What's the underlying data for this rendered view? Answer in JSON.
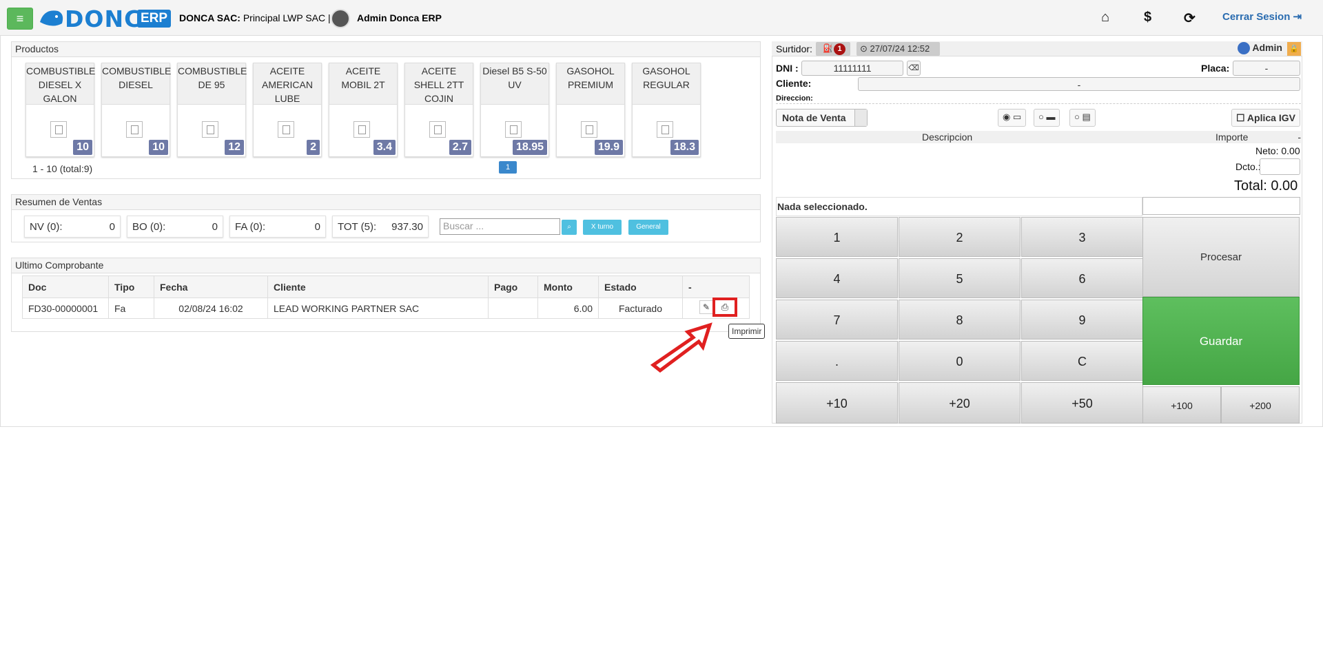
{
  "header": {
    "brand": "DONCA",
    "brand_suffix": "ERP",
    "company_label": "DONCA SAC:",
    "company_branch": "Principal LWP SAC |",
    "user": "Admin Donca ERP",
    "logout": "Cerrar Sesion"
  },
  "productos": {
    "title": "Productos",
    "pagination": "1 - 10 (total:9)",
    "page": "1",
    "items": [
      {
        "name": "COMBUSTIBLE DIESEL X GALON",
        "price": "10"
      },
      {
        "name": "COMBUSTIBLE DIESEL",
        "price": "10"
      },
      {
        "name": "COMBUSTIBLE DE 95",
        "price": "12"
      },
      {
        "name": "ACEITE AMERICAN LUBE",
        "price": "2"
      },
      {
        "name": "ACEITE MOBIL 2T",
        "price": "3.4"
      },
      {
        "name": "ACEITE SHELL 2TT COJIN",
        "price": "2.7"
      },
      {
        "name": "Diesel B5 S-50 UV",
        "price": "18.95"
      },
      {
        "name": "GASOHOL PREMIUM",
        "price": "19.9"
      },
      {
        "name": "GASOHOL REGULAR",
        "price": "18.3"
      }
    ]
  },
  "resumen": {
    "title": "Resumen de Ventas",
    "nv_label": "NV (0):",
    "nv_val": "0",
    "bo_label": "BO (0):",
    "bo_val": "0",
    "fa_label": "FA (0):",
    "fa_val": "0",
    "tot_label": "TOT (5):",
    "tot_val": "937.30",
    "search_placeholder": "Buscar ...",
    "xturno": "X turno",
    "general": "General"
  },
  "ultimo": {
    "title": "Ultimo Comprobante",
    "headers": [
      "Doc",
      "Tipo",
      "Fecha",
      "Cliente",
      "Pago",
      "Monto",
      "Estado",
      "-"
    ],
    "row": {
      "doc": "FD30-00000001",
      "tipo": "Fa",
      "fecha": "02/08/24 16:02",
      "cliente": "LEAD WORKING PARTNER SAC",
      "pago": "",
      "monto": "6.00",
      "estado": "Facturado"
    },
    "tooltip": "Imprimir"
  },
  "pos": {
    "surtidor_label": "Surtidor:",
    "surtidor_badge": "1",
    "datetime": "27/07/24 12:52",
    "admin": "Admin",
    "dni_label": "DNI :",
    "dni_value": "11111111",
    "placa_label": "Placa:",
    "placa_value": "-",
    "cliente_label": "Cliente:",
    "cliente_value": "-",
    "direccion_label": "Direccion:",
    "doc_type": "Nota de Venta",
    "aplica_igv": "Aplica IGV",
    "descripcion": "Descripcion",
    "importe": "Importe",
    "importe_val": "-",
    "neto": "Neto: 0.00",
    "dcto": "Dcto.:",
    "total": "Total: 0.00",
    "nada": "Nada seleccionado.",
    "keys": [
      "1",
      "2",
      "3",
      "4",
      "5",
      "6",
      "7",
      "8",
      "9",
      ".",
      "0",
      "C",
      "+10",
      "+20",
      "+50",
      "+100",
      "+200"
    ],
    "procesar": "Procesar",
    "guardar": "Guardar"
  }
}
